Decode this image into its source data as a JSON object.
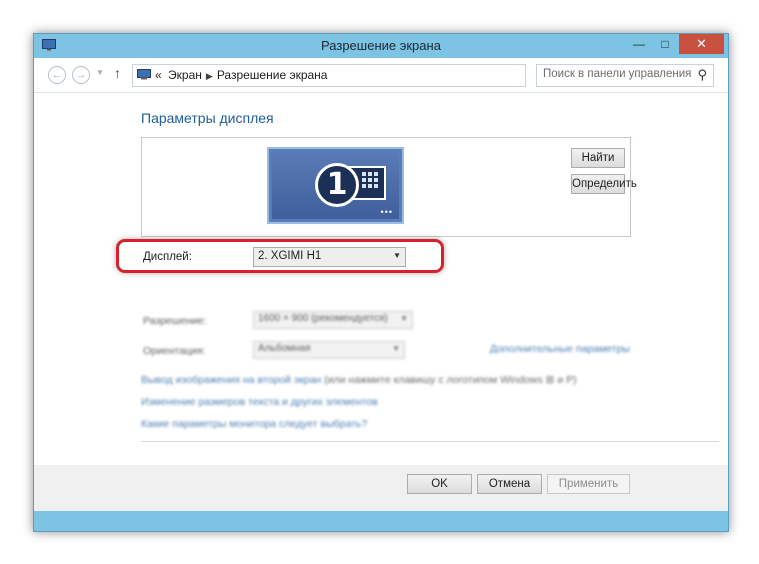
{
  "window": {
    "title": "Разрешение экрана",
    "controls": {
      "minimize": "—",
      "maximize": "□",
      "close": "✕"
    }
  },
  "address_bar": {
    "back_icon": "arrow-left-icon",
    "forward_icon": "arrow-right-icon",
    "up_icon": "arrow-up-icon",
    "path_prefix": "«",
    "path": [
      "Экран",
      "Разрешение экрана"
    ],
    "search_placeholder": "Поиск в панели управления"
  },
  "main": {
    "heading": "Параметры дисплея",
    "monitor_number": "1",
    "find_button": "Найти",
    "identify_button": "Определить",
    "display_label": "Дисплей:",
    "display_value": "2. XGIMI H1",
    "resolution_label": "Разрешение:",
    "resolution_value": "1600 × 900 (рекомендуется)",
    "orientation_label": "Ориентация:",
    "orientation_value": "Альбомная",
    "advanced_link": "Дополнительные параметры",
    "links": [
      {
        "text": "Вывод изображения на второй экран",
        "suffix": " (или нажмите клавишу с логотипом Windows ⊞ и P)"
      },
      {
        "text": "Изменение размеров текста и других элементов",
        "suffix": ""
      },
      {
        "text": "Какие параметры монитора следует выбрать?",
        "suffix": ""
      }
    ]
  },
  "footer": {
    "ok": "OK",
    "cancel": "Отмена",
    "apply": "Применить"
  },
  "colors": {
    "frame": "#7dc4e4",
    "highlight": "#d6232b",
    "link": "#1e5d9e",
    "close": "#c7503e"
  }
}
